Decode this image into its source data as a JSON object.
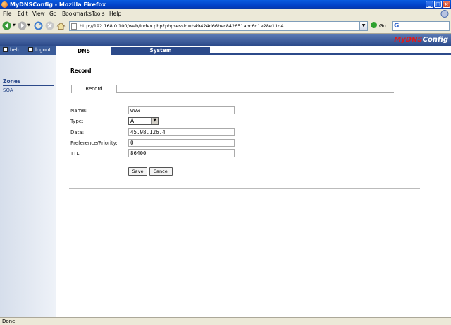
{
  "window": {
    "title": "MyDNSConfig - Mozilla Firefox"
  },
  "menubar": {
    "items": [
      "File",
      "Edit",
      "View",
      "Go",
      "Bookmarks",
      "Tools",
      "Help"
    ]
  },
  "navbar": {
    "url": "http://192.168.0.100/web/index.php?phpsessid=b49424d66bec842651abc6d1e28e11d4",
    "go_label": "Go",
    "search_value": ""
  },
  "app": {
    "logo_part1": "MyDNS",
    "logo_part2": "Config",
    "help_label": "help",
    "logout_label": "logout",
    "tabs": [
      {
        "label": "DNS",
        "active": true
      },
      {
        "label": "System",
        "active": false
      }
    ]
  },
  "sidebar": {
    "heading": "Zones",
    "items": [
      "SOA"
    ]
  },
  "content": {
    "section_title": "Record",
    "subtab": "Record",
    "fields": {
      "name": {
        "label": "Name:",
        "value": "www"
      },
      "type": {
        "label": "Type:",
        "value": "A"
      },
      "data": {
        "label": "Data:",
        "value": "45.98.126.4"
      },
      "preference": {
        "label": "Preference/Priority:",
        "value": "0"
      },
      "ttl": {
        "label": "TTL:",
        "value": "86400"
      }
    },
    "save_label": "Save",
    "cancel_label": "Cancel"
  },
  "statusbar": {
    "text": "Done"
  },
  "colors": {
    "title_bar": "#0141c8",
    "app_header": "#2c4a8a",
    "logo_accent": "#e01818",
    "sidebar_bg": "#d6deeb",
    "chrome_bg": "#ece9d8"
  }
}
